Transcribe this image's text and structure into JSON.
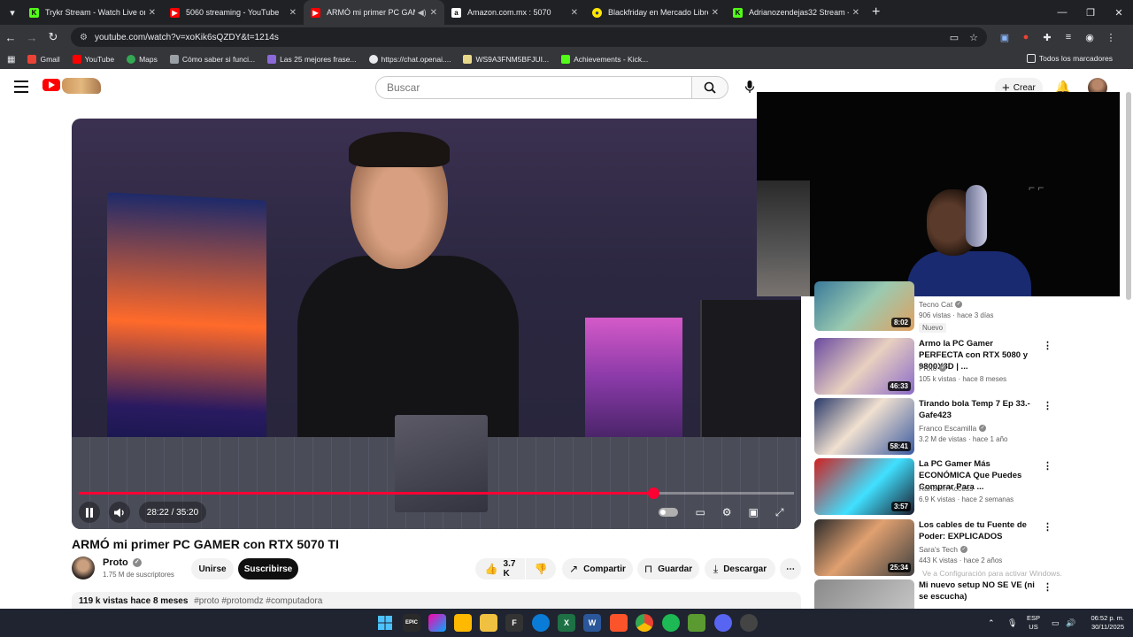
{
  "browser": {
    "tabs": [
      {
        "title": "Trykr Stream - Watch Live on Ki",
        "favicon": "kick-icon",
        "color": "#53fc18",
        "active": false
      },
      {
        "title": "5060 streaming - YouTube",
        "favicon": "youtube-icon",
        "color": "#ff0000",
        "active": false
      },
      {
        "title": "ARMÓ mi primer PC GAMER",
        "favicon": "youtube-icon",
        "color": "#ff0000",
        "active": true
      },
      {
        "title": "Amazon.com.mx : 5070",
        "favicon": "amazon-icon",
        "color": "#ffffff",
        "active": false
      },
      {
        "title": "Blackfriday en Mercado Libre M",
        "favicon": "mercadolibre-icon",
        "color": "#ffe600",
        "active": false
      },
      {
        "title": "Adrianozendejas32 Stream - W",
        "favicon": "kick-icon",
        "color": "#53fc18",
        "active": false
      }
    ],
    "new_tab": "+",
    "url": "youtube.com/watch?v=xoKik6sQZDY&t=1214s",
    "bookmarks": [
      {
        "label": "Gmail",
        "color": "#ea4335"
      },
      {
        "label": "YouTube",
        "color": "#ff0000"
      },
      {
        "label": "Maps",
        "color": "#34a853"
      },
      {
        "label": "Cómo saber si funci...",
        "color": "#9aa0a6"
      },
      {
        "label": "Las 25 mejores frase...",
        "color": "#8a6ad8"
      },
      {
        "label": "https://chat.openai....",
        "color": "#e8eaed"
      },
      {
        "label": "WS9A3FNM5BFJUI...",
        "color": "#e8d88a"
      },
      {
        "label": "Achievements - Kick...",
        "color": "#53fc18"
      }
    ],
    "all_bookmarks": "Todos los marcadores"
  },
  "youtube": {
    "search_placeholder": "Buscar",
    "create_label": "Crear",
    "video": {
      "title": "ARMÓ mi primer PC GAMER con RTX 5070 TI",
      "time": "28:22 / 35:20",
      "progress": 0.803
    },
    "channel": {
      "name": "Proto",
      "subs": "1.75 M de suscriptores",
      "join": "Unirse",
      "subscribe": "Suscribirse"
    },
    "actions": {
      "likes": "3.7 K",
      "share": "Compartir",
      "save": "Guardar",
      "download": "Descargar"
    },
    "description": {
      "views_time": "119 k vistas  hace 8 meses",
      "tags": "#proto #protomdz #computadora"
    },
    "recommendations": [
      {
        "title": "",
        "channel": "Tecno Cat",
        "meta": "906 vistas · hace 3 días",
        "duration": "8:02",
        "badge": "Nuevo"
      },
      {
        "title": "Armo la PC Gamer PERFECTA con RTX 5080 y 9800X3D | ...",
        "channel": "Proto",
        "meta": "105 k vistas · hace 8 meses",
        "duration": "46:33"
      },
      {
        "title": "Tirando bola Temp 7 Ep 33.- Gafe423",
        "channel": "Franco Escamilla",
        "meta": "3.2 M de vistas · hace 1 año",
        "duration": "58:41"
      },
      {
        "title": "La PC Gamer Más ECONÓMICA Que Puedes Comprar Para ...",
        "channel": "Random Access",
        "meta": "6.9 K vistas · hace 2 semanas",
        "duration": "3:57"
      },
      {
        "title": "Los cables de tu Fuente de Poder: EXPLICADOS",
        "channel": "Sara's Tech",
        "meta": "443 K vistas · hace 2 años",
        "duration": "25:34"
      },
      {
        "title": "Mi nuevo setup NO SE VE (ni se escucha)",
        "channel": "",
        "meta": "",
        "duration": ""
      }
    ]
  },
  "watermark": "Ve a Configuración para activar Windows.",
  "taskbar": {
    "lang": "ESP",
    "region": "US",
    "time": "06:52 p. m.",
    "date": "30/11/2025"
  }
}
